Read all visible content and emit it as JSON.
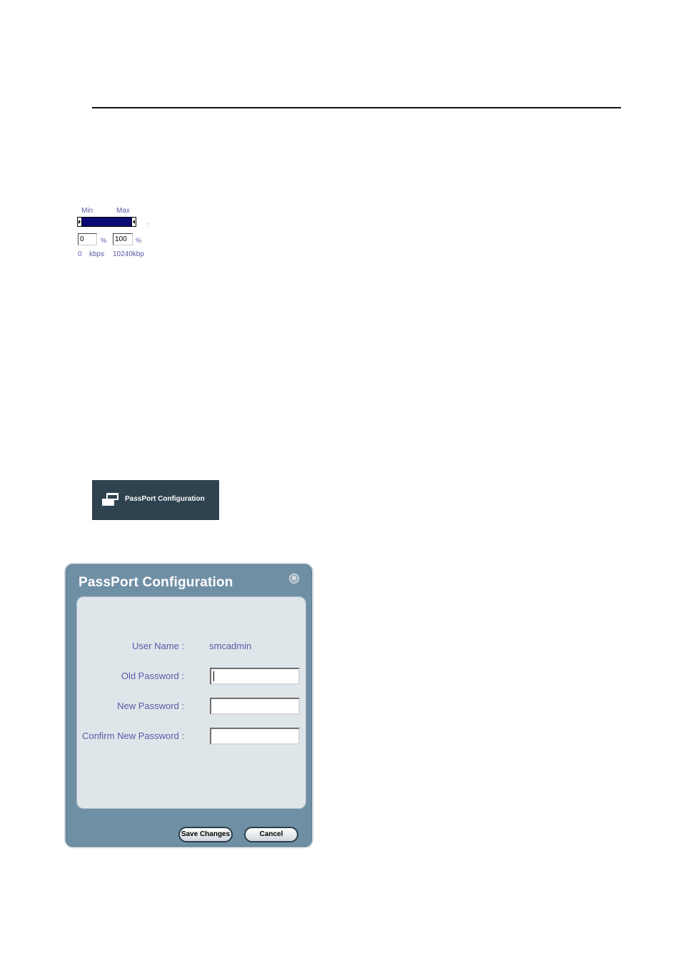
{
  "bandwidth": {
    "min_label": "Min",
    "max_label": "Max",
    "min_value": "0",
    "max_value": "100",
    "percent_unit": "%",
    "min_kbps": "0",
    "kbps_unit": "kbps",
    "max_kbps": "10240kbp"
  },
  "menu_button": {
    "label": "PassPort Configuration",
    "icon": "windows-icon"
  },
  "dialog": {
    "title": "PassPort Configuration",
    "close_icon": "close-icon",
    "user_name_label": "User Name :",
    "user_name_value": "smcadmin",
    "old_password_label": "Old Password :",
    "new_password_label": "New Password :",
    "confirm_password_label": "Confirm New Password :",
    "save_label": "Save Changes",
    "cancel_label": "Cancel"
  },
  "colors": {
    "label_text": "#5a5aa8",
    "dialog_frame": "#6f8fa4",
    "dialog_body": "#dfe6ea",
    "menu_button_bg": "#2e4250",
    "slider_track": "#0a0a72"
  }
}
